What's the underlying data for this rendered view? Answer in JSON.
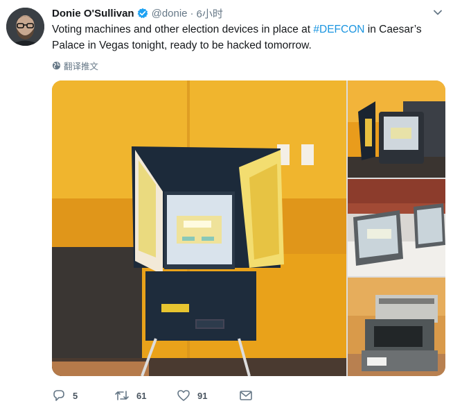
{
  "tweet": {
    "author_name": "Donie O'Sullivan",
    "handle": "@donie",
    "separator": "·",
    "time": "6小时",
    "text_before": "Voting machines and other election devices in place at ",
    "hashtag": "#DEFCON",
    "text_after": " in Caesar’s Palace in Vegas tonight, ready to be hacked tomorrow.",
    "translate_label": "翻译推文"
  },
  "actions": {
    "reply_count": "5",
    "retweet_count": "61",
    "like_count": "91"
  },
  "icons": {
    "verified": "verified-badge-icon",
    "caret": "chevron-down-icon",
    "globe": "globe-icon",
    "reply": "reply-icon",
    "retweet": "retweet-icon",
    "like": "heart-icon",
    "dm": "envelope-icon"
  },
  "colors": {
    "link": "#1b95e0",
    "muted": "#657786",
    "verified": "#1da1f2"
  }
}
